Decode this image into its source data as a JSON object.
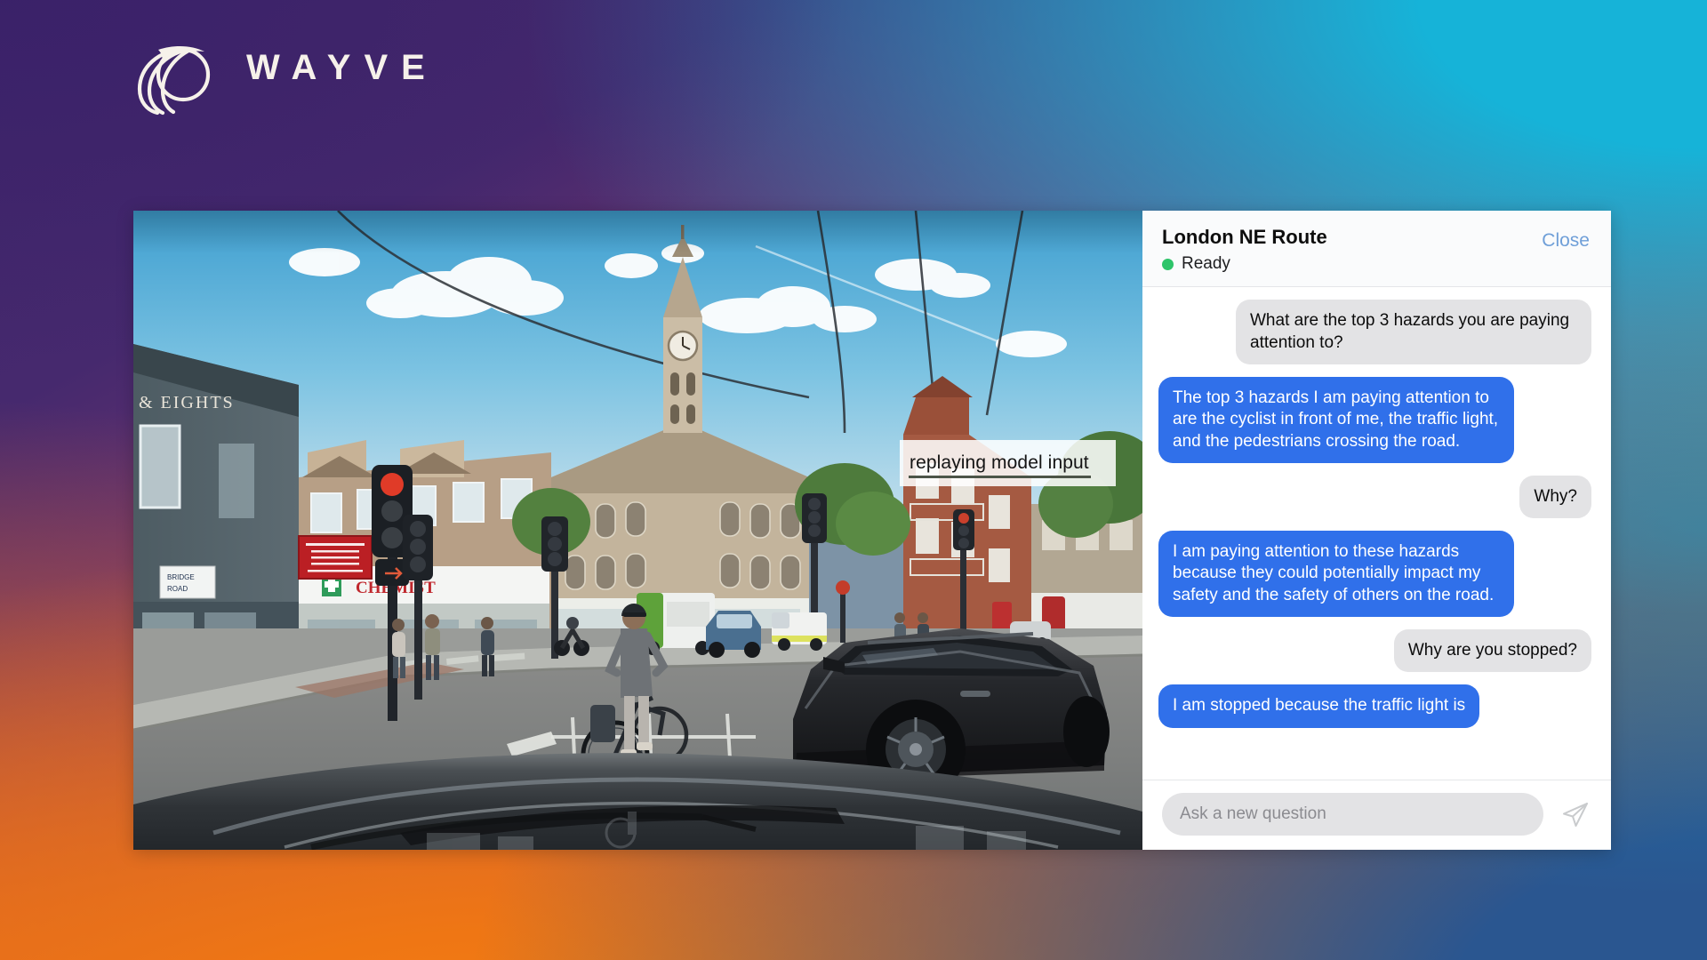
{
  "brand": {
    "name": "WAYVE",
    "logo_icon": "wayve-swirl-logo-icon",
    "logo_color": "#f6f1ea"
  },
  "background": {
    "gradient_colors": {
      "top_left": "#42296b",
      "top_right": "#16b3d8",
      "bottom_left": "#e2661e",
      "bottom_center": "#f58410",
      "bottom_right": "#2a5690"
    }
  },
  "video": {
    "overlay_badge": {
      "label": "replaying model input",
      "underline_color": "#4c5548"
    },
    "scene_description": "Dashcam forward view of a London street junction with a cyclist ahead, black SUV to the right, traffic lights and pedestrians",
    "shop_signs": [
      "CHEMIST"
    ],
    "street_sign": "BRIDGE ROAD"
  },
  "chat": {
    "title": "London NE Route",
    "status": {
      "label": "Ready",
      "dot_color": "#2ec46a"
    },
    "close_label": "Close",
    "close_color": "#6f9fd8",
    "messages": [
      {
        "role": "user",
        "text": "What are the top 3 hazards you are paying attention to?"
      },
      {
        "role": "bot",
        "text": "The top 3 hazards I am paying attention to are the cyclist in front of me, the traffic light, and the pedestrians crossing the road."
      },
      {
        "role": "user",
        "text": "Why?"
      },
      {
        "role": "bot",
        "text": "I am paying attention to these hazards because they could potentially impact my safety and the safety of others on the road."
      },
      {
        "role": "user",
        "text": "Why are you stopped?"
      },
      {
        "role": "bot",
        "text": "I am stopped because the traffic light is"
      }
    ],
    "bubble_colors": {
      "user": "#e3e3e5",
      "bot": "#3070ea"
    },
    "input": {
      "placeholder": "Ask a new question",
      "value": "",
      "send_icon": "paper-plane-send-icon"
    }
  }
}
